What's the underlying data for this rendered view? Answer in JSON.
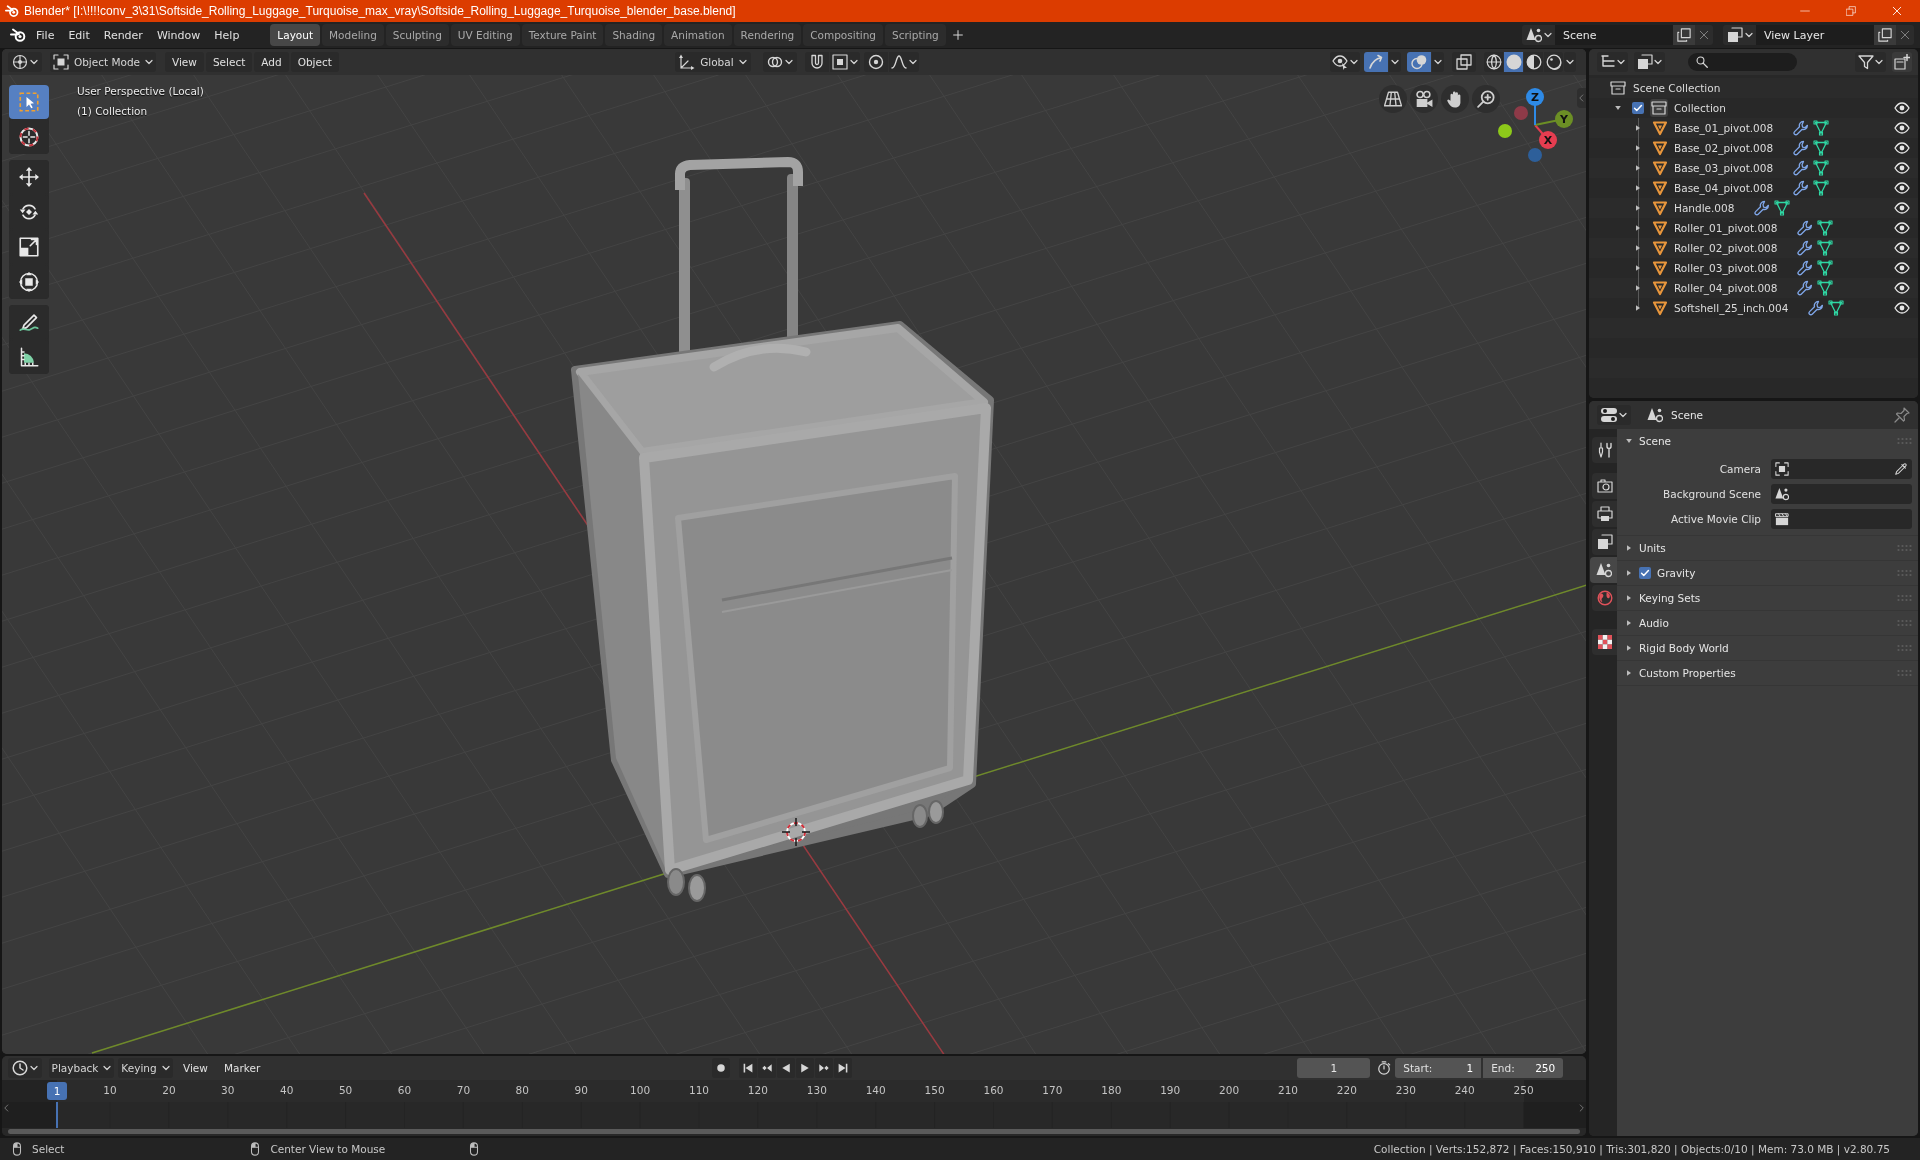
{
  "window": {
    "title": "Blender* [I:\\!!!!conv_3\\31\\Softside_Rolling_Luggage_Turquoise_max_vray\\Softside_Rolling_Luggage_Turquoise_blender_base.blend]"
  },
  "menu": [
    "File",
    "Edit",
    "Render",
    "Window",
    "Help"
  ],
  "workspace_tabs": [
    {
      "label": "Layout",
      "selected": true
    },
    {
      "label": "Modeling",
      "selected": false
    },
    {
      "label": "Sculpting",
      "selected": false
    },
    {
      "label": "UV Editing",
      "selected": false
    },
    {
      "label": "Texture Paint",
      "selected": false
    },
    {
      "label": "Shading",
      "selected": false
    },
    {
      "label": "Animation",
      "selected": false
    },
    {
      "label": "Rendering",
      "selected": false
    },
    {
      "label": "Compositing",
      "selected": false
    },
    {
      "label": "Scripting",
      "selected": false
    }
  ],
  "scene_selector": {
    "value": "Scene"
  },
  "view_layer_selector": {
    "value": "View Layer"
  },
  "viewport": {
    "header": {
      "mode": "Object Mode",
      "menus": [
        "View",
        "Select",
        "Add",
        "Object"
      ],
      "orientation": "Global",
      "snap": {
        "on": false
      },
      "proportional_editing": {
        "on": false
      },
      "gizmos": {
        "on": true
      },
      "overlays": {
        "on": true
      },
      "xray": {
        "on": false
      },
      "shading": [
        {
          "kind": "wireframe",
          "selected": false
        },
        {
          "kind": "solid",
          "selected": true
        },
        {
          "kind": "material",
          "selected": false
        },
        {
          "kind": "rendered",
          "selected": false
        }
      ]
    },
    "overlay": {
      "view": "User Perspective (Local)",
      "context": "(1) Collection"
    },
    "tool_groups": [
      {
        "tools": [
          {
            "kind": "select_box",
            "selected": true
          },
          {
            "kind": "cursor",
            "selected": false
          }
        ]
      },
      {
        "tools": [
          {
            "kind": "move",
            "selected": false
          },
          {
            "kind": "rotate",
            "selected": false
          },
          {
            "kind": "scale",
            "selected": false
          },
          {
            "kind": "transform",
            "selected": false
          }
        ]
      },
      {
        "tools": [
          {
            "kind": "annotate",
            "selected": false
          },
          {
            "kind": "measure",
            "selected": false
          }
        ]
      }
    ],
    "gizmo_axes": [
      {
        "kind": "x",
        "label": "X",
        "color": "#e63d50"
      },
      {
        "kind": "y",
        "label": "Y",
        "color": "#6c8f25"
      },
      {
        "kind": "z",
        "label": "Z",
        "color": "#2e8ae6"
      }
    ]
  },
  "outliner": {
    "root": "Scene Collection",
    "collections": [
      {
        "name": "Collection",
        "checked": true,
        "expanded": true,
        "visible": true,
        "children": [
          {
            "name": "Base_01_pivot.008",
            "expanded": false,
            "visible": true
          },
          {
            "name": "Base_02_pivot.008",
            "expanded": false,
            "visible": true
          },
          {
            "name": "Base_03_pivot.008",
            "expanded": false,
            "visible": true
          },
          {
            "name": "Base_04_pivot.008",
            "expanded": false,
            "visible": true
          },
          {
            "name": "Handle.008",
            "expanded": false,
            "visible": true
          },
          {
            "name": "Roller_01_pivot.008",
            "expanded": false,
            "visible": true
          },
          {
            "name": "Roller_02_pivot.008",
            "expanded": false,
            "visible": true
          },
          {
            "name": "Roller_03_pivot.008",
            "expanded": false,
            "visible": true
          },
          {
            "name": "Roller_04_pivot.008",
            "expanded": false,
            "visible": true
          },
          {
            "name": "Softshell_25_inch.004",
            "expanded": false,
            "visible": true
          }
        ]
      }
    ]
  },
  "properties": {
    "context": "Scene",
    "tabs": [
      {
        "kind": "tool",
        "selected": false
      },
      {
        "kind": "render",
        "selected": false
      },
      {
        "kind": "output",
        "selected": false
      },
      {
        "kind": "view_layer",
        "selected": false
      },
      {
        "kind": "scene",
        "selected": true
      },
      {
        "kind": "world",
        "selected": false
      },
      {
        "kind": "texture",
        "selected": false
      }
    ],
    "panels": [
      {
        "title": "Scene",
        "expanded": true,
        "fields": [
          {
            "label": "Camera",
            "kind": "camera"
          },
          {
            "label": "Background Scene",
            "kind": "scene"
          },
          {
            "label": "Active Movie Clip",
            "kind": "clip"
          }
        ]
      },
      {
        "title": "Units",
        "expanded": false
      },
      {
        "title": "Gravity",
        "expanded": false,
        "checked": true
      },
      {
        "title": "Keying Sets",
        "expanded": false
      },
      {
        "title": "Audio",
        "expanded": false
      },
      {
        "title": "Rigid Body World",
        "expanded": false
      },
      {
        "title": "Custom Properties",
        "expanded": false
      }
    ]
  },
  "timeline": {
    "menus": [
      {
        "label": "Playback",
        "kind": "dropdown"
      },
      {
        "label": "Keying",
        "kind": "dropdown"
      },
      {
        "label": "View",
        "kind": "menu"
      },
      {
        "label": "Marker",
        "kind": "menu"
      }
    ],
    "current_frame": "1",
    "start_label": "Start:",
    "start": "1",
    "end_label": "End:",
    "end": "250",
    "playhead": "1",
    "ruler": [
      "10",
      "20",
      "30",
      "40",
      "50",
      "60",
      "70",
      "80",
      "90",
      "100",
      "110",
      "120",
      "130",
      "140",
      "150",
      "160",
      "170",
      "180",
      "190",
      "200",
      "210",
      "220",
      "230",
      "240",
      "250"
    ]
  },
  "status_bar": {
    "hints": [
      {
        "label": "Select"
      },
      {
        "label": "Center View to Mouse"
      }
    ],
    "stats": "Collection | Verts:152,872 | Faces:150,910 | Tris:301,820 | Objects:0/10 | Mem: 73.0 MB | v2.80.75"
  }
}
